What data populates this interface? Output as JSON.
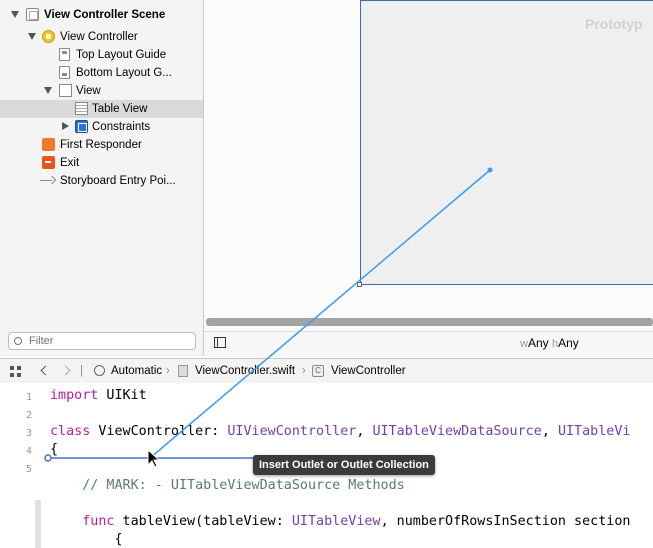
{
  "outline": {
    "items": [
      {
        "label": "View Controller Scene"
      },
      {
        "label": "View Controller"
      },
      {
        "label": "Top Layout Guide"
      },
      {
        "label": "Bottom Layout G..."
      },
      {
        "label": "View"
      },
      {
        "label": "Table View"
      },
      {
        "label": "Constraints"
      },
      {
        "label": "First Responder"
      },
      {
        "label": "Exit"
      },
      {
        "label": "Storyboard Entry Poi..."
      }
    ],
    "filter_placeholder": "Filter"
  },
  "canvas": {
    "scene_title": "Prototyp",
    "size_class": {
      "w_prefix": "w",
      "w_value": "Any",
      "h_prefix": "h",
      "h_value": "Any"
    }
  },
  "jumpbar": {
    "mode": "Automatic",
    "file": "ViewController.swift",
    "class_icon_letter": "C",
    "class": "ViewController"
  },
  "editor": {
    "line_numbers": [
      "1",
      "2",
      "3",
      "4",
      "5",
      "",
      "",
      ""
    ],
    "lines": {
      "l1_kw": "import",
      "l1_rest": " UIKit",
      "l3_kw": "class",
      "l3_name": " ViewController: ",
      "l3_t1": "UIViewController",
      "l3_c1": ", ",
      "l3_t2": "UITableViewDataSource",
      "l3_c2": ", ",
      "l3_t3": "UITableVi",
      "l4": "{",
      "l6_comment": "    // MARK: - UITableViewDataSource Methods",
      "l8_kw": "    func",
      "l8_rest": " tableView(tableView: ",
      "l8_type": "UITableView",
      "l8_tail": ", numberOfRowsInSection section",
      "l9": "        {"
    }
  },
  "tooltip": "Insert Outlet or Outlet Collection",
  "colors": {
    "connection_line": "#3a9df0",
    "keyword": "#b51fa0",
    "type": "#6f3fb1",
    "comment": "#5a7a6e"
  },
  "icons": [
    "scene-icon",
    "view-controller-icon",
    "layout-guide-icon",
    "view-icon",
    "table-view-icon",
    "constraints-icon",
    "first-responder-icon",
    "exit-icon",
    "entry-point-arrow-icon",
    "filter-icon",
    "grid-icon",
    "back-chevron-icon",
    "forward-chevron-icon",
    "automatic-icon",
    "swift-file-icon",
    "class-icon",
    "pointer-cursor-icon"
  ]
}
